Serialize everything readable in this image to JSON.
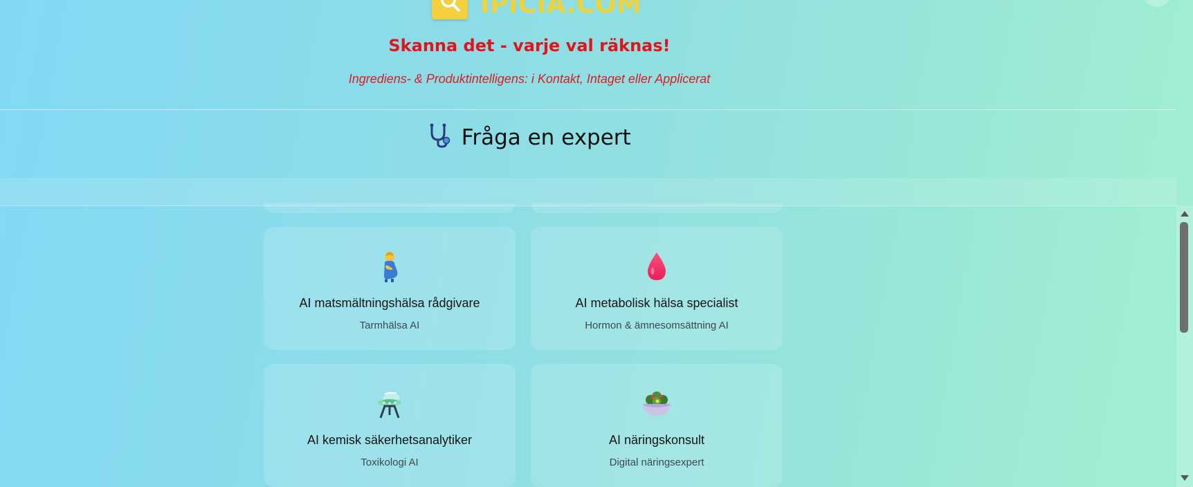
{
  "header": {
    "logo_text": "IPICIA.COM",
    "slogan": "Skanna det - varje val räknas!",
    "tagline": "Ingrediens- & Produktintelligens: i Kontakt, Intaget eller Applicerat"
  },
  "section": {
    "icon": "stethoscope-icon",
    "title": "Fråga en expert"
  },
  "experts": [
    {
      "icon": "pregnant-person-icon",
      "title": "AI matsmältningshälsa rådgivare",
      "subtitle": "Tarmhälsa AI"
    },
    {
      "icon": "blood-drop-icon",
      "title": "AI metabolisk hälsa specialist",
      "subtitle": "Hormon & ämnesomsättning AI"
    },
    {
      "icon": "ufo-icon",
      "title": "AI kemisk säkerhetsanalytiker",
      "subtitle": "Toxikologi AI"
    },
    {
      "icon": "salad-bowl-icon",
      "title": "AI näringskonsult",
      "subtitle": "Digital näringsexpert"
    }
  ],
  "colors": {
    "slogan": "#e0141a",
    "logo": "#f0d23a",
    "background_start": "#83d9f4",
    "background_end": "#a3efd2"
  }
}
